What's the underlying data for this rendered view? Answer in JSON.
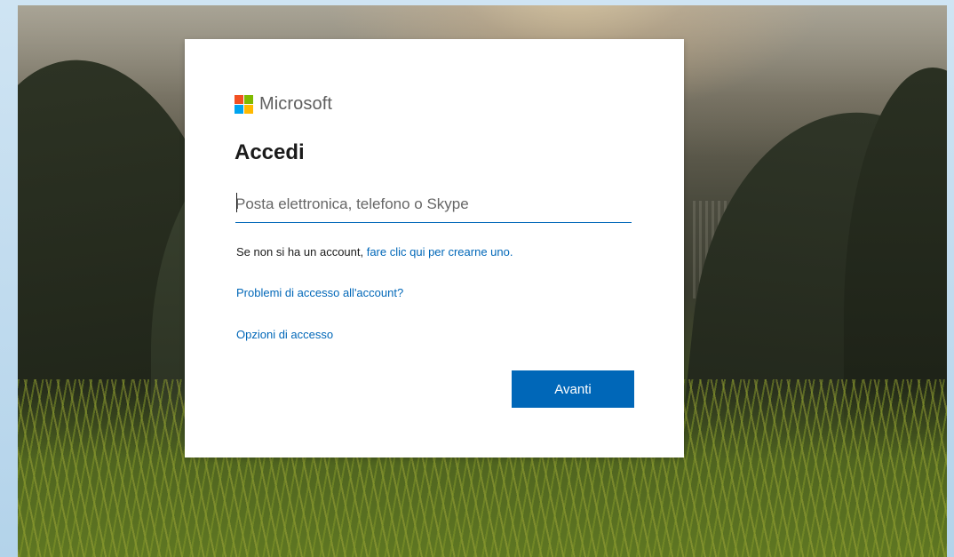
{
  "brand": {
    "name": "Microsoft",
    "logo_colors": [
      "#f25022",
      "#7fba00",
      "#00a4ef",
      "#ffb900"
    ]
  },
  "signin": {
    "title": "Accedi",
    "email_placeholder": "Posta elettronica, telefono o Skype",
    "email_value": "",
    "no_account_text": "Se non si ha un account, ",
    "create_account_link": "fare clic qui per crearne uno.",
    "trouble_link": "Problemi di accesso all'account?",
    "options_link": "Opzioni di accesso",
    "next_button": "Avanti"
  },
  "colors": {
    "accent": "#0067b8",
    "card_bg": "#ffffff",
    "text": "#1b1b1b"
  }
}
